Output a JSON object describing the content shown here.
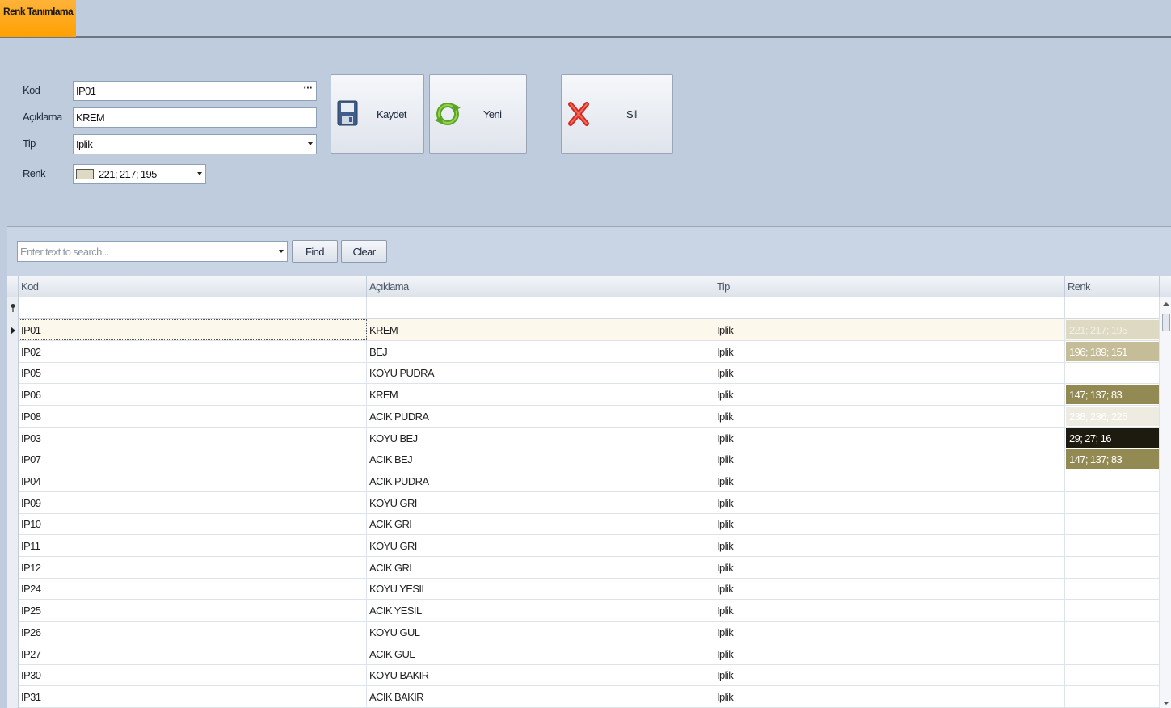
{
  "tabs": [
    {
      "label": "Renk Tanımlama",
      "active": true
    }
  ],
  "form": {
    "kod_label": "Kod",
    "kod_value": "IP01",
    "aciklama_label": "Açıklama",
    "aciklama_value": "KREM",
    "tip_label": "Tip",
    "tip_value": "Iplik",
    "renk_label": "Renk",
    "renk_value": "221; 217; 195",
    "renk_color": "#ddd9c3"
  },
  "toolbar": {
    "kaydet_label": "Kaydet",
    "yeni_label": "Yeni",
    "sil_label": "Sil"
  },
  "search": {
    "placeholder": "Enter text to search...",
    "find_label": "Find",
    "clear_label": "Clear"
  },
  "grid": {
    "columns": [
      "Kod",
      "Açıklama",
      "Tip",
      "Renk"
    ],
    "rows": [
      {
        "kod": "IP01",
        "aciklama": "KREM",
        "tip": "Iplik",
        "renk": "221; 217; 195",
        "color": "#ddd9c3",
        "text_color": "#f3f1e6"
      },
      {
        "kod": "IP02",
        "aciklama": "BEJ",
        "tip": "Iplik",
        "renk": "196; 189; 151",
        "color": "#c4bd97",
        "text_color": "#ffffff"
      },
      {
        "kod": "IP05",
        "aciklama": "KOYU PUDRA",
        "tip": "Iplik",
        "renk": "",
        "color": "",
        "text_color": ""
      },
      {
        "kod": "IP06",
        "aciklama": "KREM",
        "tip": "Iplik",
        "renk": "147; 137; 83",
        "color": "#938953",
        "text_color": "#ffffff"
      },
      {
        "kod": "IP08",
        "aciklama": "ACIK PUDRA",
        "tip": "Iplik",
        "renk": "238; 236; 225",
        "color": "#eeece1",
        "text_color": "#ffffff"
      },
      {
        "kod": "IP03",
        "aciklama": "KOYU BEJ",
        "tip": "Iplik",
        "renk": "29; 27; 16",
        "color": "#1d1b10",
        "text_color": "#ffffff"
      },
      {
        "kod": "IP07",
        "aciklama": "ACIK BEJ",
        "tip": "Iplik",
        "renk": "147; 137; 83",
        "color": "#938953",
        "text_color": "#ffffff"
      },
      {
        "kod": "IP04",
        "aciklama": "ACIK PUDRA",
        "tip": "Iplik",
        "renk": "",
        "color": "",
        "text_color": ""
      },
      {
        "kod": "IP09",
        "aciklama": "KOYU GRI",
        "tip": "Iplik",
        "renk": "",
        "color": "",
        "text_color": ""
      },
      {
        "kod": "IP10",
        "aciklama": "ACIK GRI",
        "tip": "Iplik",
        "renk": "",
        "color": "",
        "text_color": ""
      },
      {
        "kod": "IP11",
        "aciklama": "KOYU GRI",
        "tip": "Iplik",
        "renk": "",
        "color": "",
        "text_color": ""
      },
      {
        "kod": "IP12",
        "aciklama": "ACIK GRI",
        "tip": "Iplik",
        "renk": "",
        "color": "",
        "text_color": ""
      },
      {
        "kod": "IP24",
        "aciklama": "KOYU YESIL",
        "tip": "Iplik",
        "renk": "",
        "color": "",
        "text_color": ""
      },
      {
        "kod": "IP25",
        "aciklama": "ACIK YESIL",
        "tip": "Iplik",
        "renk": "",
        "color": "",
        "text_color": ""
      },
      {
        "kod": "IP26",
        "aciklama": "KOYU GUL",
        "tip": "Iplik",
        "renk": "",
        "color": "",
        "text_color": ""
      },
      {
        "kod": "IP27",
        "aciklama": "ACIK GUL",
        "tip": "Iplik",
        "renk": "",
        "color": "",
        "text_color": ""
      },
      {
        "kod": "IP30",
        "aciklama": "KOYU BAKIR",
        "tip": "Iplik",
        "renk": "",
        "color": "",
        "text_color": ""
      },
      {
        "kod": "IP31",
        "aciklama": "ACIK BAKIR",
        "tip": "Iplik",
        "renk": "",
        "color": "",
        "text_color": ""
      }
    ],
    "selected_index": 0
  }
}
